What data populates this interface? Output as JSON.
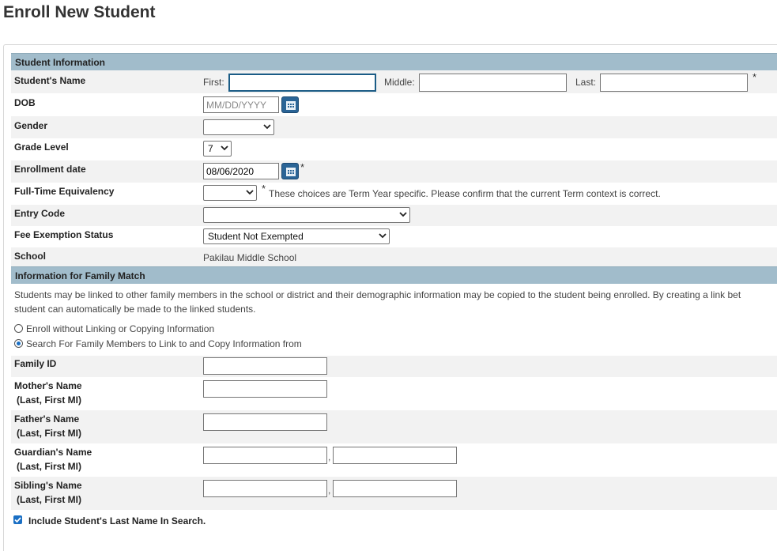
{
  "page": {
    "title": "Enroll New Student"
  },
  "sections": {
    "student_info": "Student Information",
    "family_match": "Information for Family Match"
  },
  "student": {
    "name_label": "Student's Name",
    "first_label": "First:",
    "middle_label": "Middle:",
    "last_label": "Last:",
    "first_value": "",
    "middle_value": "",
    "last_value": "",
    "required_mark": "*",
    "dob_label": "DOB",
    "dob_placeholder": "MM/DD/YYYY",
    "gender_label": "Gender",
    "gender_value": "",
    "grade_label": "Grade Level",
    "grade_value": "7",
    "enroll_date_label": "Enrollment date",
    "enroll_date_value": "08/06/2020",
    "fte_label": "Full-Time Equivalency",
    "fte_value": "",
    "fte_note": "These choices are Term Year specific. Please confirm that the current Term context is correct.",
    "entry_code_label": "Entry Code",
    "entry_code_value": "",
    "fee_label": "Fee Exemption Status",
    "fee_value": "Student Not Exempted",
    "school_label": "School",
    "school_value": "Pakilau Middle School"
  },
  "family": {
    "description": "Students may be linked to other family members in the school or district and their demographic information may be copied to the student being enrolled. By creating a link bet",
    "description_line2": "student can automatically be made to the linked students.",
    "option_no_link": "Enroll without Linking or Copying Information",
    "option_search": "Search For Family Members to Link to and Copy Information from",
    "selected_option": "search",
    "family_id_label": "Family ID",
    "mother_label": "Mother's Name",
    "father_label": "Father's Name",
    "guardian_label": "Guardian's Name",
    "sibling_label": "Sibling's Name",
    "name_format": "(Last, First MI)",
    "comma": ",",
    "include_last_name_label": "Include Student's Last Name In Search.",
    "include_last_name_checked": true
  }
}
